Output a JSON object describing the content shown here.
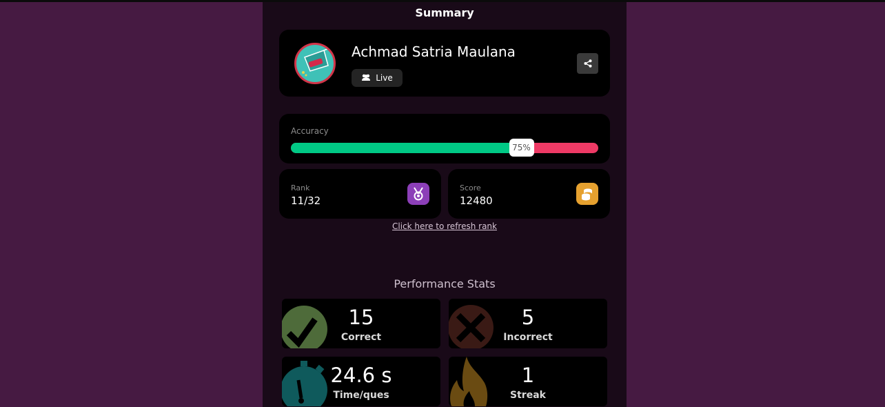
{
  "summary": {
    "title": "Summary"
  },
  "profile": {
    "name": "Achmad Satria Maulana",
    "badge_label": "Live",
    "badge_icon": "group-icon",
    "share_icon": "share-icon"
  },
  "accuracy": {
    "label": "Accuracy",
    "percent": 75,
    "percent_label": "75%",
    "correct_color": "#00c985",
    "incorrect_color": "#ee3a65"
  },
  "rank": {
    "label": "Rank",
    "value": "11/32",
    "icon": "medal-icon"
  },
  "score": {
    "label": "Score",
    "value": "12480",
    "icon": "coins-icon"
  },
  "refresh_link": "Click here to refresh rank",
  "performance": {
    "title": "Performance Stats",
    "stats": [
      {
        "value": "15",
        "label": "Correct",
        "icon": "check-icon",
        "color": "#4e6b3a"
      },
      {
        "value": "5",
        "label": "Incorrect",
        "icon": "cross-icon",
        "color": "#3a1a15"
      },
      {
        "value": "24.6 s",
        "label": "Time/ques",
        "icon": "stopwatch-icon",
        "color": "#0f5a5c"
      },
      {
        "value": "1",
        "label": "Streak",
        "icon": "fire-icon",
        "color": "#6a4b12"
      }
    ]
  }
}
